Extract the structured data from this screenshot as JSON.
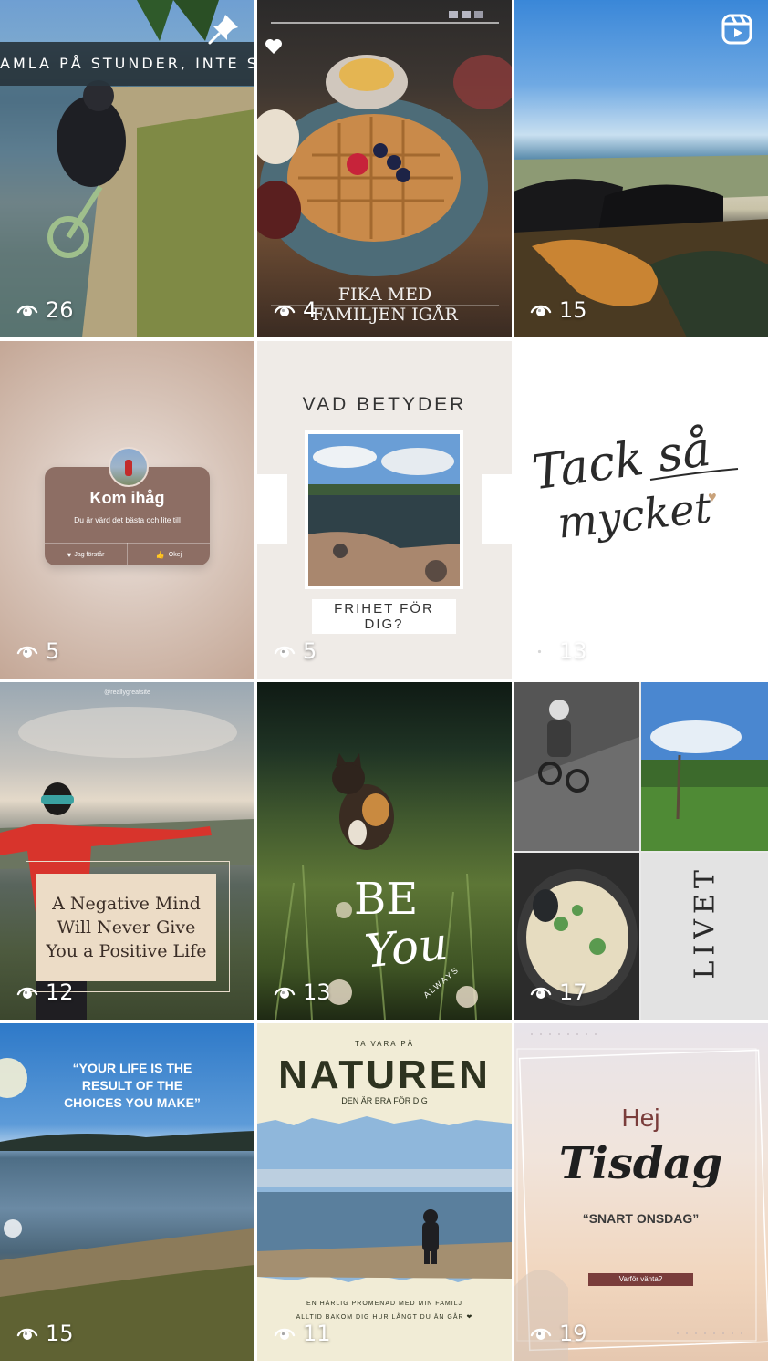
{
  "tiles": [
    {
      "id": "t1",
      "views": "26",
      "banner": "AMLA PÅ STUNDER, INTE SAKE",
      "pinned": true
    },
    {
      "id": "t2",
      "views": "4",
      "caption_line1": "FIKA MED",
      "caption_line2": "FAMILJEN IGÅR"
    },
    {
      "id": "t3",
      "views": "15",
      "reel": true
    },
    {
      "id": "t4",
      "views": "5",
      "card_title": "Kom ihåg",
      "card_text": "Du är värd det bästa och lite till",
      "btn_left": "Jag förstår",
      "btn_right": "Okej"
    },
    {
      "id": "t5",
      "views": "5",
      "title": "VAD BETYDER",
      "subtitle": "FRIHET FÖR DIG?"
    },
    {
      "id": "t6",
      "views": "13",
      "script_line1": "Tack så",
      "script_line2": "mycket"
    },
    {
      "id": "t7",
      "views": "12",
      "handle": "@reallygreatsite",
      "quote": "A Negative Mind Will Never Give You a Positive Life"
    },
    {
      "id": "t8",
      "views": "13",
      "be": "BE",
      "you": "You",
      "always": "ALWAYS"
    },
    {
      "id": "t9",
      "views": "17",
      "word": "LIVET"
    },
    {
      "id": "t10",
      "views": "15",
      "quote": "“YOUR LIFE IS THE RESULT OF THE CHOICES YOU MAKE”"
    },
    {
      "id": "t11",
      "views": "11",
      "kicker": "TA VARA PÅ",
      "title": "NATUREN",
      "subtitle": "DEN ÄR BRA FÖR DIG",
      "bottom1": "EN HÄRLIG PROMENAD MED MIN FAMILJ",
      "bottom2": "ALLTID BAKOM DIG HUR LÅNGT DU ÄN GÅR ❤"
    },
    {
      "id": "t12",
      "views": "19",
      "hej": "Hej",
      "tisdag": "Tisdag",
      "sub": "“SNART ONSDAG”",
      "button": "Varför vänta?"
    }
  ],
  "colors": {
    "card_brown": "#8d6e64",
    "naturen_dark": "#2e3320",
    "tag_brown": "#7a3d3b"
  },
  "icons": {
    "views": "eye-icon",
    "pinned": "pin-icon",
    "reel": "reels-icon",
    "heart": "heart-icon"
  }
}
